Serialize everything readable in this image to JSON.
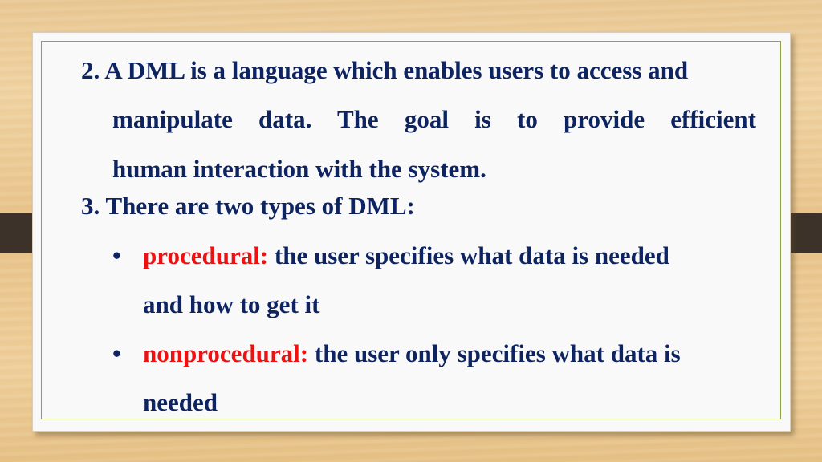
{
  "slide": {
    "item2": {
      "line1": "2. A DML is a language which enables users to access and",
      "line2": "manipulate data. The goal is to provide efficient",
      "line3": "human interaction with the system."
    },
    "item3": {
      "heading": "3. There are two types of DML:",
      "bullets": [
        {
          "term": "procedural:",
          "text_line1": " the user specifies what data is needed",
          "text_line2": "and how to get it"
        },
        {
          "term": "nonprocedural:",
          "text_line1": " the user only specifies what data is",
          "text_line2": "needed"
        }
      ]
    },
    "bullet_glyph": "•",
    "colors": {
      "text": "#0d2461",
      "term": "#ee1111",
      "border": "#8ea24a",
      "tab": "#3d3229"
    }
  }
}
